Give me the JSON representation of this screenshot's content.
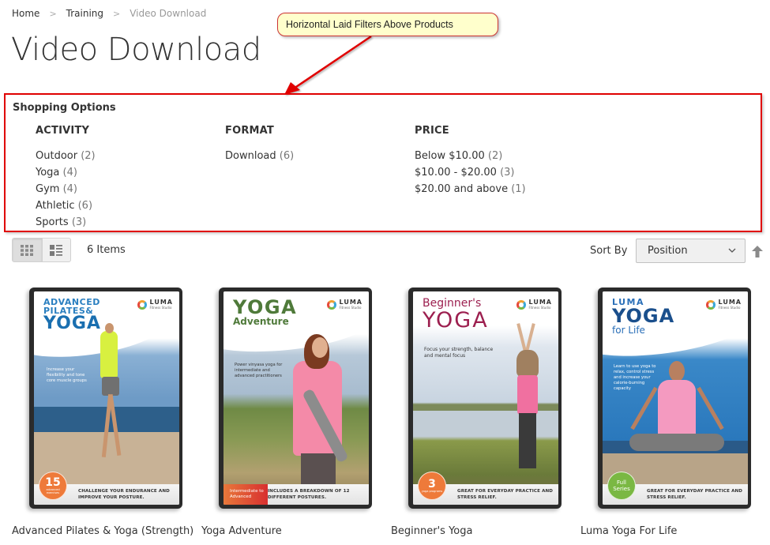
{
  "breadcrumb": [
    {
      "label": "Home"
    },
    {
      "label": "Training"
    },
    {
      "label": "Video Download"
    }
  ],
  "breadcrumb_separator": ">",
  "page_title": "Video Download",
  "annotation": {
    "callout_text": "Horizontal Laid Filters Above Products",
    "highlight_color": "#e00000",
    "callout_bg": "#ffffcc"
  },
  "filters": {
    "title": "Shopping Options",
    "groups": [
      {
        "title": "ACTIVITY",
        "options": [
          {
            "label": "Outdoor",
            "count": "(2)"
          },
          {
            "label": "Yoga",
            "count": "(4)"
          },
          {
            "label": "Gym",
            "count": "(4)"
          },
          {
            "label": "Athletic",
            "count": "(6)"
          },
          {
            "label": "Sports",
            "count": "(3)"
          }
        ]
      },
      {
        "title": "FORMAT",
        "options": [
          {
            "label": "Download",
            "count": "(6)"
          }
        ]
      },
      {
        "title": "PRICE",
        "options": [
          {
            "label": "Below $10.00",
            "count": "(2)"
          },
          {
            "label": "$10.00 - $20.00",
            "count": "(3)"
          },
          {
            "label": "$20.00 and above",
            "count": "(1)"
          }
        ]
      }
    ]
  },
  "toolbar": {
    "view_modes": [
      {
        "name": "grid",
        "icon": "grid-icon",
        "active": true
      },
      {
        "name": "list",
        "icon": "list-icon",
        "active": false
      }
    ],
    "items_count": "6 Items",
    "sort_label": "Sort By",
    "sort_selected": "Position",
    "sort_direction_icon": "arrow-up-icon"
  },
  "products": [
    {
      "name": "Advanced Pilates & Yoga (Strength)",
      "cover": {
        "title_lines": [
          "ADVANCED",
          "PILATES&",
          "YOGA"
        ],
        "title_color": "#1a6fb0",
        "blurb": "Increase your flexibility and tone core muscle groups",
        "tagline": "CHALLENGE YOUR ENDURANCE AND IMPROVE YOUR POSTURE.",
        "badge_main": "15",
        "badge_sub": "advanced exercises",
        "badge_color": "#ee7a3a",
        "logo": "LUMA",
        "logo_sub": "Fitness Studio"
      }
    },
    {
      "name": "Yoga Adventure",
      "cover": {
        "title_lines": [
          "YOGA",
          "Adventure"
        ],
        "title_color": "#4f7a3a",
        "blurb": "Power vinyasa yoga for intermediate and advanced practitioners",
        "tagline": "INCLUDES A BREAKDOWN OF 12 DIFFERENT POSTURES.",
        "ribbon": "Intermediate to Advanced",
        "logo": "LUMA",
        "logo_sub": "Fitness Studio"
      }
    },
    {
      "name": "Beginner's Yoga",
      "cover": {
        "title_lines": [
          "Beginner's",
          "YOGA"
        ],
        "title_color": "#9c1f4f",
        "blurb": "Focus your strength, balance and mental focus",
        "tagline": "GREAT FOR EVERYDAY PRACTICE AND STRESS RELIEF.",
        "badge_main": "3",
        "badge_sub": "yoga programs",
        "badge_color": "#ee7a3a",
        "logo": "LUMA",
        "logo_sub": "Fitness Studio"
      }
    },
    {
      "name": "Luma Yoga For Life",
      "cover": {
        "title_lines": [
          "LUMA",
          "YOGA",
          "for Life"
        ],
        "title_color": "#1a4f8c",
        "blurb": "Learn to use yoga to relax, control stress and increase your calorie-burning capacity",
        "tagline": "GREAT FOR EVERYDAY PRACTICE AND STRESS RELIEF.",
        "badge_text": "Full Series",
        "badge_color": "#7ab843",
        "logo": "LUMA",
        "logo_sub": "Fitness Studio"
      }
    }
  ]
}
